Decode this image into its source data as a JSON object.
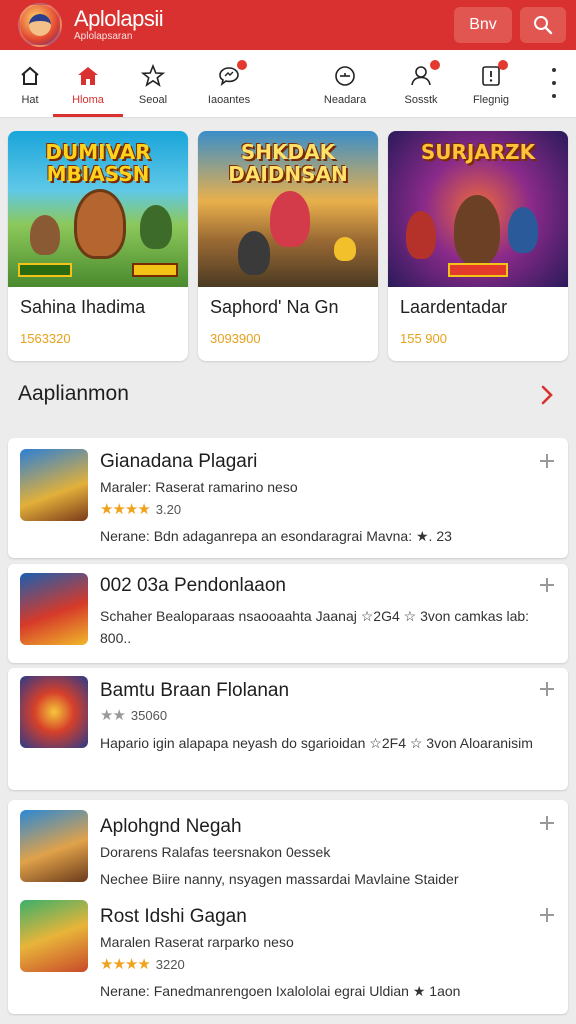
{
  "app": {
    "title": "Aplolapsii",
    "subtitle": "Aplolapsaran"
  },
  "header": {
    "text_button": "Bnv",
    "search_icon": "search-icon"
  },
  "nav": {
    "items": [
      {
        "label": "Hat",
        "icon": "home-outline-icon",
        "badge": false,
        "active": false
      },
      {
        "label": "Hloma",
        "icon": "home-filled-icon",
        "badge": false,
        "active": true
      },
      {
        "label": "Seoal",
        "icon": "star-outline-icon",
        "badge": false,
        "active": false
      },
      {
        "label": "Iaoantes",
        "icon": "chat-icon",
        "badge": true,
        "active": false
      },
      {
        "label": "Neadara",
        "icon": "compass-icon",
        "badge": false,
        "active": false
      },
      {
        "label": "Sosstk",
        "icon": "people-icon",
        "badge": true,
        "active": false
      },
      {
        "label": "Flegnig",
        "icon": "notification-icon",
        "badge": true,
        "active": false
      }
    ]
  },
  "featured": [
    {
      "art_title": "DUMIVAR MBIASSN",
      "title": "Sahina Ihadima",
      "count": "1563320"
    },
    {
      "art_title": "SHKDAK DAIDNSAN",
      "title": "Saphord' Na Gn",
      "count": "3093900"
    },
    {
      "art_title": "SURJARZK",
      "title": "Laardentadar",
      "count": "155 900"
    }
  ],
  "section": {
    "title": "Aaplianmon"
  },
  "list": [
    {
      "title": "Gianadana Plagari",
      "subtitle": "Maraler: Raserat ramarino neso",
      "rating_stars": "★★★★",
      "rating_value": "3.20",
      "desc": "Nerane: Bdn adaganrepa an esondaragrai Mavna: ★. 23"
    },
    {
      "title": "002 03a Pendonlaaon",
      "subtitle": "",
      "rating_stars": "",
      "rating_value": "",
      "desc": "Schaher Bealoparaas nsaooaahta Jaanaj ☆2G4 ☆ 3von camkas lab: 800.."
    },
    {
      "title": "Bamtu Braan Flolanan",
      "subtitle": "",
      "rating_stars": "★★",
      "rating_value": "35060",
      "desc": "Hapario igin alapapa neyash do sgarioidan ☆2F4 ☆ 3von Aloaranisim"
    },
    {
      "title": "Aplohgnd Negah",
      "subtitle": "Dorarens Ralafas teersnakon 0essek",
      "rating_stars": "",
      "rating_value": "",
      "desc": "Nechee Biire nanny, nsyagen massardai Mavlaine Staider"
    },
    {
      "title": "Rost Idshi Gagan",
      "subtitle": "Maralen Raserat rarparko neso",
      "rating_stars": "★★★★",
      "rating_value": "3220",
      "desc": "Nerane: Fanedmanrengoen Ixalololai egrai Uldian ★ 1aon"
    }
  ],
  "colors": {
    "brand": "#d8312f",
    "star": "#f0a21c",
    "count": "#e7a11b"
  }
}
